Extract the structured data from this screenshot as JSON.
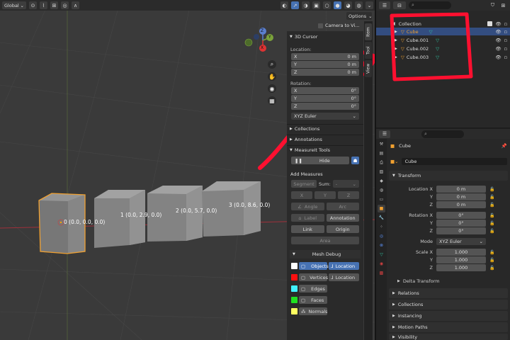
{
  "topbar": {
    "orientation": "Global",
    "options_label": "Options"
  },
  "viewport": {
    "camera_to_view": "Camera to Vi...",
    "cube_labels": [
      "0 (0.0, 0.0, 0.0)",
      "1 (0.0, 2.9, 0.0)",
      "2 (0.0, 5.7, 0.0)",
      "3 (0.0, 8.6, 0.0)"
    ],
    "gizmo": {
      "z": "Z",
      "y": "Y",
      "x": "X"
    }
  },
  "npanel": {
    "cursor_title": "3D Cursor",
    "location_label": "Location:",
    "location": [
      {
        "axis": "X",
        "value": "0 m"
      },
      {
        "axis": "Y",
        "value": "0 m"
      },
      {
        "axis": "Z",
        "value": "0 m"
      }
    ],
    "rotation_label": "Rotation:",
    "rotation": [
      {
        "axis": "X",
        "value": "0°"
      },
      {
        "axis": "Y",
        "value": "0°"
      },
      {
        "axis": "Z",
        "value": "0°"
      }
    ],
    "euler_mode": "XYZ Euler",
    "collections": "Collections",
    "annotations": "Annotations",
    "measureit": "MeasureIt Tools",
    "hide": "Hide",
    "add_measures": "Add Measures",
    "segment": "Segment",
    "sum": "Sum:",
    "sum_value": "-",
    "x": "X",
    "y": "Y",
    "z": "Z",
    "angle": "Angle",
    "arc": "Arc",
    "label": "Label",
    "annotation": "Annotation",
    "link": "Link",
    "origin": "Origin",
    "area": "Area",
    "mesh_debug": "Mesh Debug",
    "objects": "Objects",
    "location_btn": "Location",
    "vertices": "Vertices",
    "location_btn2": "Location",
    "edges": "Edges",
    "faces": "Faces",
    "normals": "Normals"
  },
  "sidetabs": {
    "item": "Item",
    "tool": "Tool",
    "view": "View"
  },
  "outliner": {
    "collection": "Collection",
    "items": [
      "Cube",
      "Cube.001",
      "Cube.002",
      "Cube.003"
    ]
  },
  "properties": {
    "object_name": "Cube",
    "datablock_name": "Cube",
    "transform": "Transform",
    "location_x": "Location X",
    "y": "Y",
    "z": "Z",
    "loc": [
      "0 m",
      "0 m",
      "0 m"
    ],
    "rotation_x": "Rotation X",
    "rot": [
      "0°",
      "0°",
      "0°"
    ],
    "mode": "Mode",
    "mode_value": "XYZ Euler",
    "scale_x": "Scale X",
    "scale": [
      "1.000",
      "1.000",
      "1.000"
    ],
    "delta": "Delta Transform",
    "relations": "Relations",
    "collections": "Collections",
    "instancing": "Instancing",
    "motion_paths": "Motion Paths",
    "visibility": "Visibility"
  },
  "colors": {
    "accent": "#4772b3",
    "selection_outline": "#f0a030",
    "annotation_red": "#ff1030",
    "grid_green": "#7ba33b",
    "grid_red": "#a0303a"
  }
}
